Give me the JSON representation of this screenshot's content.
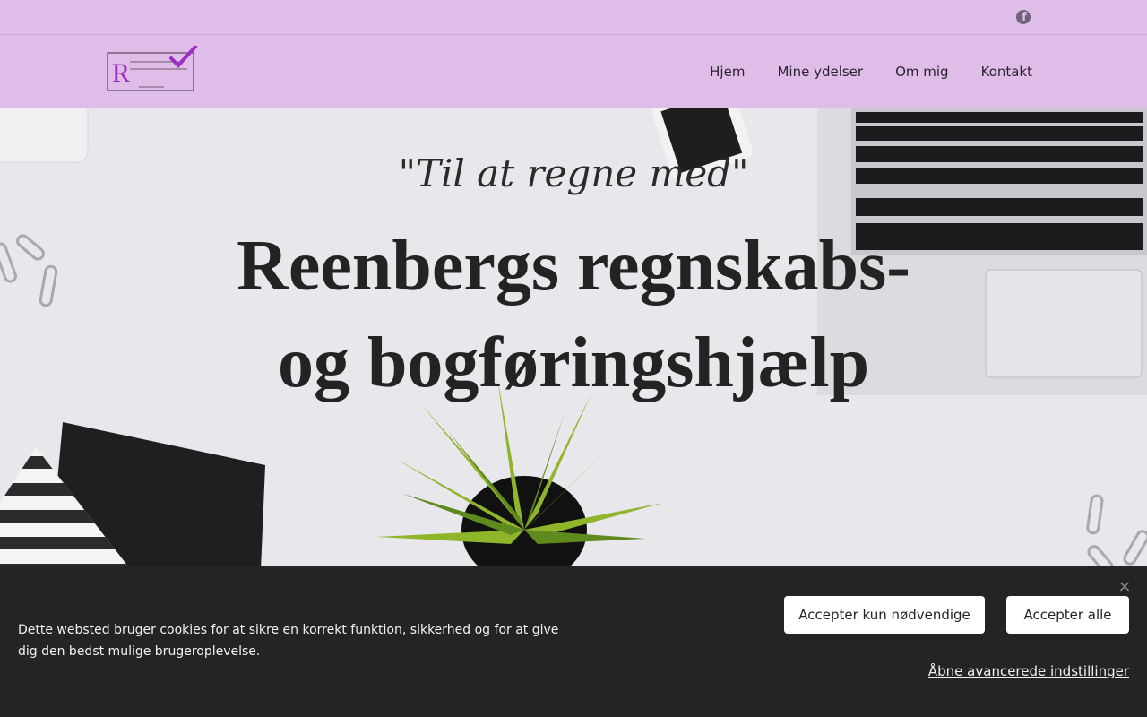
{
  "topbar": {
    "social_icon": "facebook-icon",
    "social_glyph": "f"
  },
  "header": {
    "logo_letter": "R",
    "nav": [
      {
        "label": "Hjem"
      },
      {
        "label": "Mine ydelser"
      },
      {
        "label": "Om mig"
      },
      {
        "label": "Kontakt"
      }
    ]
  },
  "hero": {
    "tagline": "\"Til at regne med\"",
    "headline_line1": "Reenbergs regnskabs-",
    "headline_line2": "og bogføringshjælp"
  },
  "cookie": {
    "text": "Dette websted bruger cookies for at sikre en korrekt funktion, sikkerhed og for at give dig den bedst mulige brugeroplevelse.",
    "accept_necessary": "Accepter kun nødvendige",
    "accept_all": "Accepter alle",
    "advanced": "Åbne avancerede indstillinger",
    "close_glyph": "×"
  },
  "colors": {
    "brand_bg": "#e0bde8",
    "banner_bg": "#242424",
    "logo_accent": "#9b2fc4"
  }
}
